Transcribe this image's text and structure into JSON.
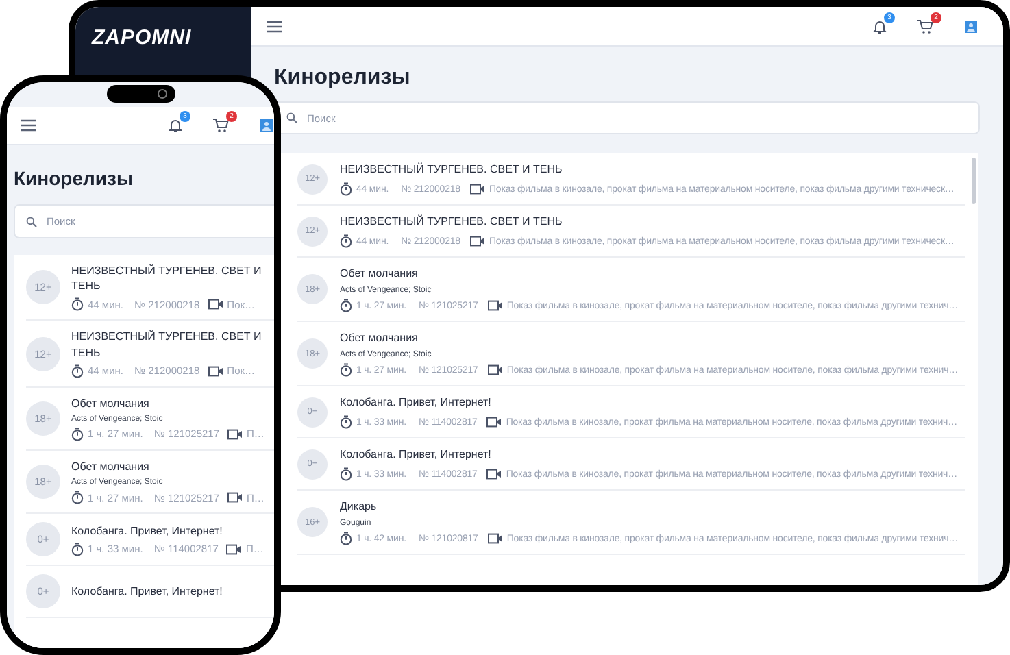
{
  "tablet": {
    "logo": "ZAPOMNI",
    "header": {
      "notifications_badge": "3",
      "cart_badge": "2"
    },
    "title": "Кинорелизы",
    "search": {
      "placeholder": "Поиск"
    },
    "films": [
      {
        "age": "12+",
        "title": "НЕИЗВЕСТНЫЙ ТУРГЕНЕВ. СВЕТ И ТЕНЬ",
        "duration": "44 мин.",
        "number": "№ 212000218",
        "license": "Показ фильма в кинозале, прокат фильма на материальном носителе, показ фильма другими техническ…"
      },
      {
        "age": "12+",
        "title": "НЕИЗВЕСТНЫЙ ТУРГЕНЕВ. СВЕТ И ТЕНЬ",
        "duration": "44 мин.",
        "number": "№ 212000218",
        "license": "Показ фильма в кинозале, прокат фильма на материальном носителе, показ фильма другими техническ…"
      },
      {
        "age": "18+",
        "title": "Обет молчания",
        "subtitle": "Acts of Vengeance; Stoic",
        "duration": "1 ч. 27 мин.",
        "number": "№ 121025217",
        "license": "Показ фильма в кинозале, прокат фильма на материальном носителе, показ фильма другими технич…"
      },
      {
        "age": "18+",
        "title": "Обет молчания",
        "subtitle": "Acts of Vengeance; Stoic",
        "duration": "1 ч. 27 мин.",
        "number": "№ 121025217",
        "license": "Показ фильма в кинозале, прокат фильма на материальном носителе, показ фильма другими технич…"
      },
      {
        "age": "0+",
        "title": "Колобанга. Привет, Интернет!",
        "duration": "1 ч. 33 мин.",
        "number": "№ 114002817",
        "license": "Показ фильма в кинозале, прокат фильма на материальном носителе, показ фильма другими технич…"
      },
      {
        "age": "0+",
        "title": "Колобанга. Привет, Интернет!",
        "duration": "1 ч. 33 мин.",
        "number": "№ 114002817",
        "license": "Показ фильма в кинозале, прокат фильма на материальном носителе, показ фильма другими технич…"
      },
      {
        "age": "16+",
        "title": "Дикарь",
        "subtitle": "Gouguin",
        "duration": "1 ч. 42 мин.",
        "number": "№ 121020817",
        "license": "Показ фильма в кинозале, прокат фильма на материальном носителе, показ фильма другими технич…"
      }
    ]
  },
  "phone": {
    "header": {
      "notifications_badge": "3",
      "cart_badge": "2"
    },
    "title": "Кинорелизы",
    "search": {
      "placeholder": "Поиск"
    },
    "films": [
      {
        "age": "12+",
        "title": "НЕИЗВЕСТНЫЙ ТУРГЕНЕВ. СВЕТ И ТЕНЬ",
        "duration": "44 мин.",
        "number": "№ 212000218",
        "license": "Пок…"
      },
      {
        "age": "12+",
        "title": "НЕИЗВЕСТНЫЙ ТУРГЕНЕВ. СВЕТ И ТЕНЬ",
        "duration": "44 мин.",
        "number": "№ 212000218",
        "license": "Пок…"
      },
      {
        "age": "18+",
        "title": "Обет молчания",
        "subtitle": "Acts of Vengeance; Stoic",
        "duration": "1 ч. 27 мин.",
        "number": "№ 121025217",
        "license": "П…"
      },
      {
        "age": "18+",
        "title": "Обет молчания",
        "subtitle": "Acts of Vengeance; Stoic",
        "duration": "1 ч. 27 мин.",
        "number": "№ 121025217",
        "license": "П…"
      },
      {
        "age": "0+",
        "title": "Колобанга. Привет, Интернет!",
        "duration": "1 ч. 33 мин.",
        "number": "№ 114002817",
        "license": "П…"
      },
      {
        "age": "0+",
        "title": "Колобанга. Привет, Интернет!"
      }
    ]
  }
}
